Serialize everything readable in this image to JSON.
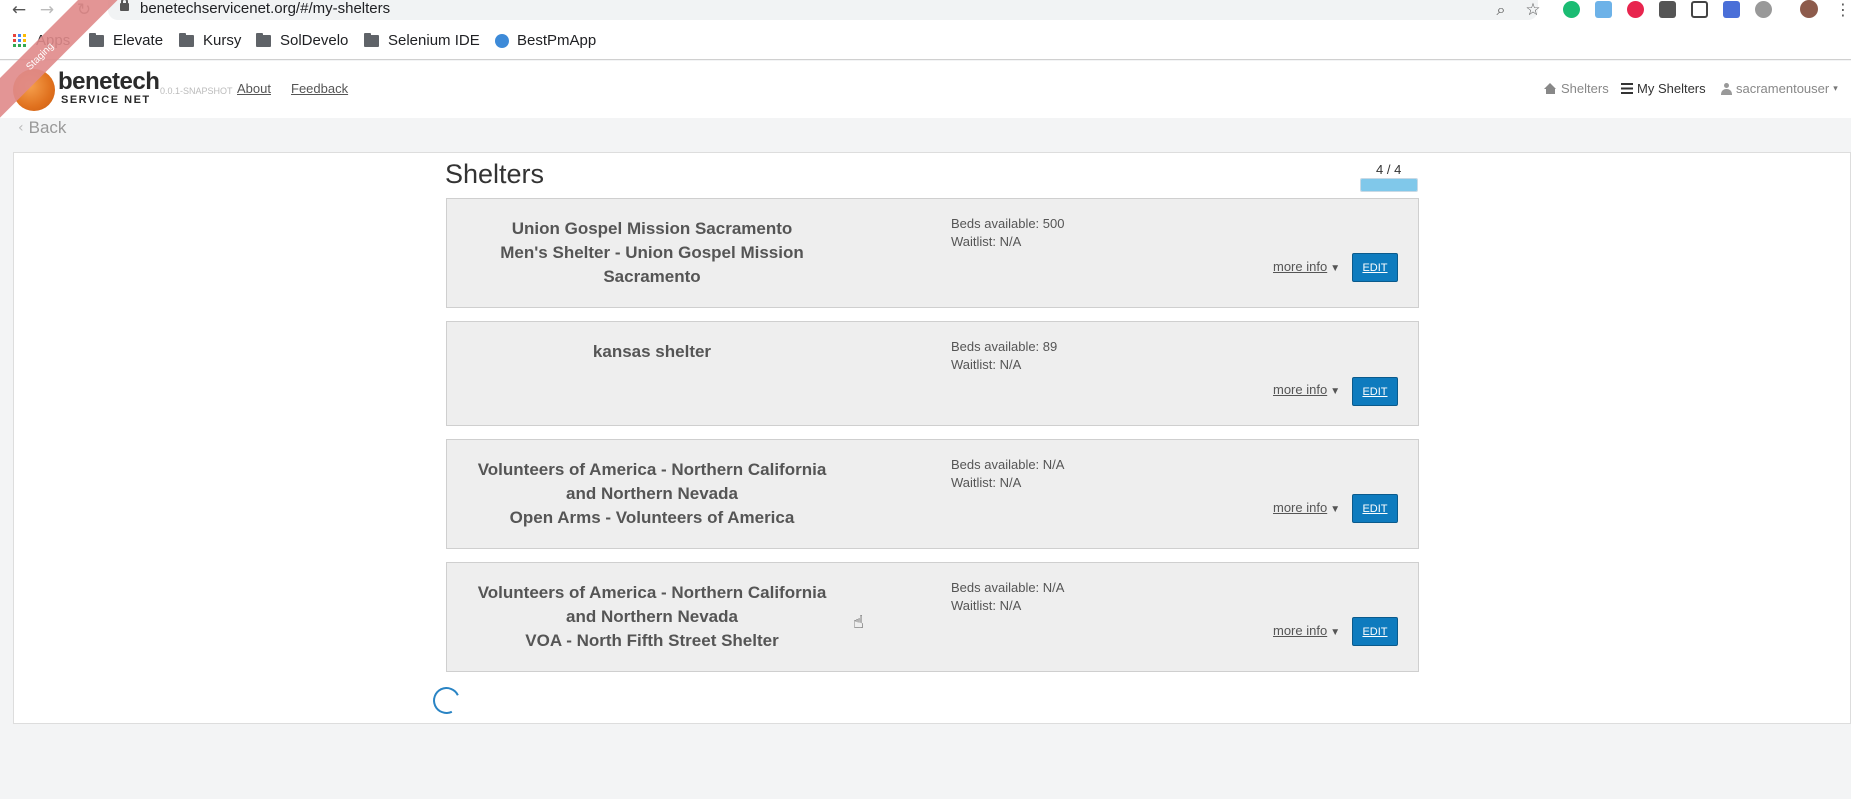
{
  "browser": {
    "url": "benetechservicenet.org/#/my-shelters",
    "back_glyph": "←",
    "forward_glyph": "→",
    "reload_glyph": "↻",
    "zoom_glyph": "⌕",
    "star_glyph": "☆",
    "kebab_glyph": "⋮",
    "extension_colors": [
      "#1bbc73",
      "#6db2e8",
      "#e8254e",
      "#555555",
      "#444444",
      "#4a6fd8",
      "#999999"
    ]
  },
  "bookmarks": [
    {
      "label": "Apps",
      "icon": "apps-icon"
    },
    {
      "label": "Elevate",
      "icon": "folder-icon"
    },
    {
      "label": "Kursy",
      "icon": "folder-icon"
    },
    {
      "label": "SolDevelo",
      "icon": "folder-icon"
    },
    {
      "label": "Selenium IDE",
      "icon": "folder-icon"
    },
    {
      "label": "BestPmApp",
      "icon": "bestpmapp-icon"
    }
  ],
  "header": {
    "logo_title": "benetech",
    "logo_subtitle": "SERVICE NET",
    "version": "0.0.1-SNAPSHOT",
    "about": "About",
    "feedback": "Feedback",
    "nav_shelters": "Shelters",
    "nav_my_shelters": "My Shelters",
    "user": "sacramentouser",
    "caret": "▾",
    "ribbon": "Staging"
  },
  "back": {
    "chevron": "‹",
    "label": "Back"
  },
  "page": {
    "title": "Shelters",
    "counter": "4 / 4",
    "progress_fraction": 1.0
  },
  "shelters": [
    {
      "name_line1": "Union Gospel Mission Sacramento",
      "name_line2": "Men's Shelter - Union Gospel Mission Sacramento",
      "beds": "Beds available: 500",
      "waitlist": "Waitlist: N/A",
      "more_info": "more info",
      "more_info_glyph": "▼",
      "edit": "EDIT"
    },
    {
      "name_line1": "kansas shelter",
      "name_line2": "",
      "beds": "Beds available: 89",
      "waitlist": "Waitlist: N/A",
      "more_info": "more info",
      "more_info_glyph": "▼",
      "edit": "EDIT"
    },
    {
      "name_line1": "Volunteers of America - Northern California and Northern Nevada",
      "name_line2": "Open Arms - Volunteers of America",
      "beds": "Beds available: N/A",
      "waitlist": "Waitlist: N/A",
      "more_info": "more info",
      "more_info_glyph": "▼",
      "edit": "EDIT"
    },
    {
      "name_line1": "Volunteers of America - Northern California and Northern Nevada",
      "name_line2": "VOA - North Fifth Street Shelter",
      "beds": "Beds available: N/A",
      "waitlist": "Waitlist: N/A",
      "more_info": "more info",
      "more_info_glyph": "▼",
      "edit": "EDIT"
    }
  ],
  "colors": {
    "edit_button": "#0e7bbe",
    "progress_fill": "#80c8ea",
    "card_bg": "#eeeeee",
    "page_bg": "#f3f4f5"
  }
}
